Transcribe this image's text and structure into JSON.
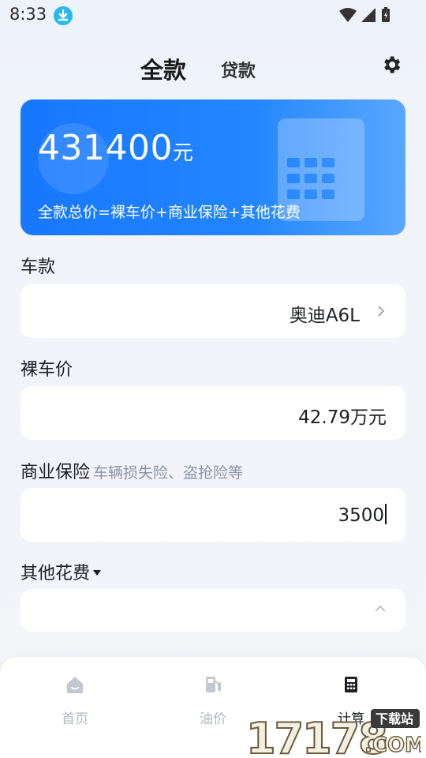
{
  "status": {
    "time": "8:33"
  },
  "tabs": {
    "active": "全款",
    "loan": "贷款"
  },
  "banner": {
    "total": "431400",
    "unit": "元",
    "formula": "全款总价=裸车价+商业保险+其他花费"
  },
  "fields": {
    "car": {
      "label": "车款",
      "value": "奥迪A6L"
    },
    "price": {
      "label": "裸车价",
      "value": "42.79万元"
    },
    "insurance": {
      "label": "商业保险",
      "hint": "车辆损失险、盗抢险等",
      "value": "3500"
    },
    "other": {
      "label": "其他花费"
    }
  },
  "nav": [
    {
      "label": "首页",
      "icon": "home-icon"
    },
    {
      "label": "油价",
      "icon": "fuel-icon"
    },
    {
      "label": "计算",
      "icon": "calculator-icon"
    }
  ],
  "watermark": {
    "number": "17178",
    "site": "下载站",
    "domain": ".COM"
  },
  "colors": {
    "accent": "#1677ff",
    "inactive": "#b1b6c1"
  }
}
